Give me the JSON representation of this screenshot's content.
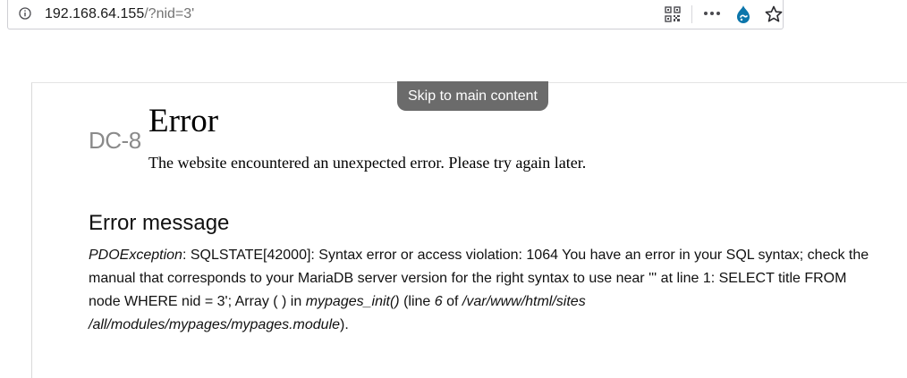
{
  "browser": {
    "url_host": "192.168.64.155",
    "url_path": "/?nid=3'",
    "icons": [
      "info-icon",
      "qr-code-icon",
      "more-icon",
      "drupal-icon",
      "star-icon"
    ]
  },
  "page": {
    "skip_link": "Skip to main content",
    "site_name": "DC-8",
    "title": "Error",
    "intro": "The website encountered an unexpected error. Please try again later."
  },
  "error": {
    "heading": "Error message",
    "exception": "PDOException",
    "text_1": ": SQLSTATE[42000]: Syntax error or access violation: 1064 You have an error in your SQL syntax; check the manual that corresponds to your MariaDB server version for the right syntax to use near ''' at line 1: SELECT title FROM node WHERE nid = 3'; Array ( ) in ",
    "function": "mypages_init()",
    "text_2": " (line ",
    "line": "6",
    "text_3": " of ",
    "path_line1": "/var/www/html/sites",
    "path_line2": "/all/modules/mypages/mypages.module",
    "text_4": ")."
  }
}
